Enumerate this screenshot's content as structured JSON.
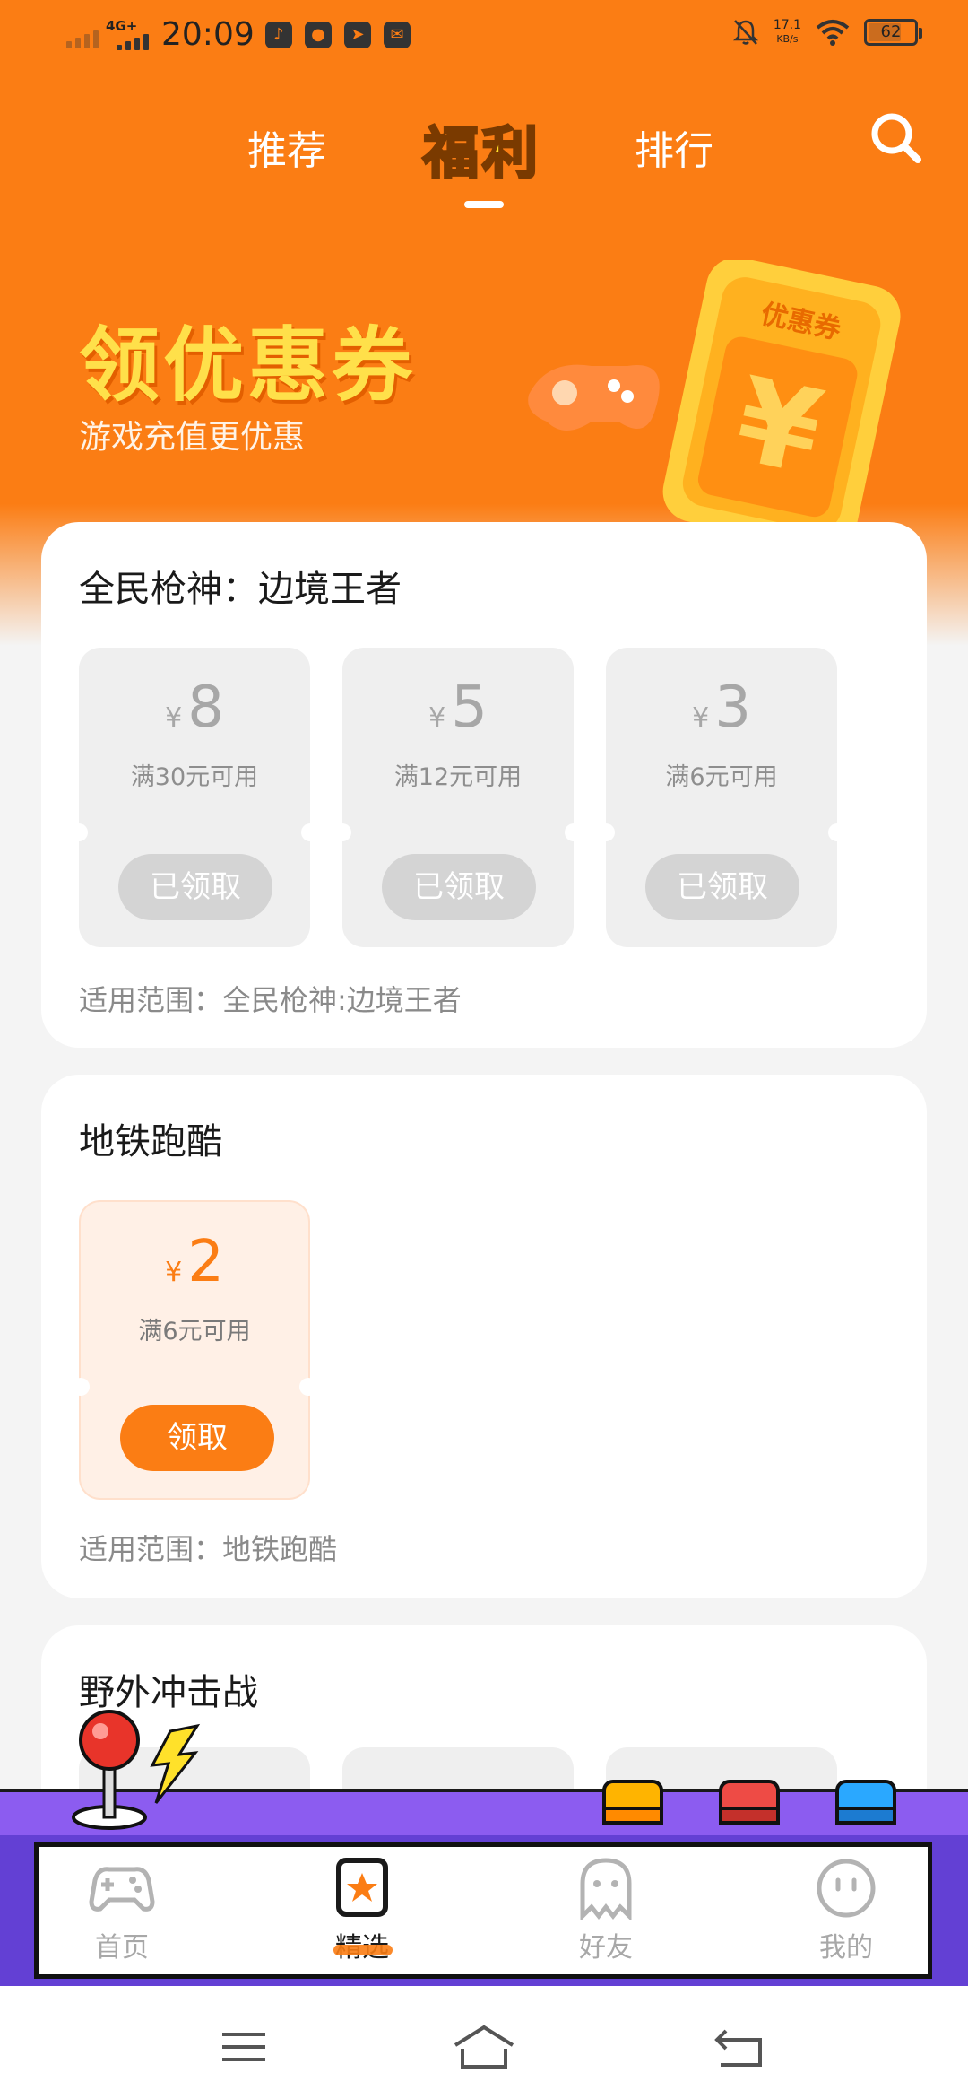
{
  "status_bar": {
    "network": "4G+",
    "time": "20:09",
    "speed_value": "17.1",
    "speed_unit": "KB/s",
    "battery": "62"
  },
  "top_nav": {
    "tabs": [
      {
        "label": "推荐",
        "active": false
      },
      {
        "label": "福利",
        "active": true
      },
      {
        "label": "排行",
        "active": false
      }
    ]
  },
  "banner": {
    "title": "领优惠券",
    "subtitle": "游戏充值更优惠",
    "art_label": "优惠券",
    "art_symbol": "¥"
  },
  "cards": [
    {
      "title": "全民枪神：边境王者",
      "coupons": [
        {
          "currency": "¥",
          "amount": "8",
          "condition": "满30元可用",
          "button": "已领取",
          "claimed": true
        },
        {
          "currency": "¥",
          "amount": "5",
          "condition": "满12元可用",
          "button": "已领取",
          "claimed": true
        },
        {
          "currency": "¥",
          "amount": "3",
          "condition": "满6元可用",
          "button": "已领取",
          "claimed": true
        }
      ],
      "scope": "适用范围：全民枪神:边境王者"
    },
    {
      "title": "地铁跑酷",
      "coupons": [
        {
          "currency": "¥",
          "amount": "2",
          "condition": "满6元可用",
          "button": "领取",
          "claimed": false
        }
      ],
      "scope": "适用范围：地铁跑酷"
    },
    {
      "title": "野外冲击战",
      "coupons": [],
      "scope": ""
    }
  ],
  "bottom_tabs": [
    {
      "label": "首页",
      "icon": "gamepad-icon",
      "active": false
    },
    {
      "label": "精选",
      "icon": "star-bookmark-icon",
      "active": true
    },
    {
      "label": "好友",
      "icon": "ghost-icon",
      "active": false
    },
    {
      "label": "我的",
      "icon": "smiley-icon",
      "active": false
    }
  ],
  "colors": {
    "accent": "#fb7d14",
    "banner_title": "#ffe04a",
    "disabled_button": "#d4d4d4",
    "arcade_purple": "#8c5cf0"
  }
}
